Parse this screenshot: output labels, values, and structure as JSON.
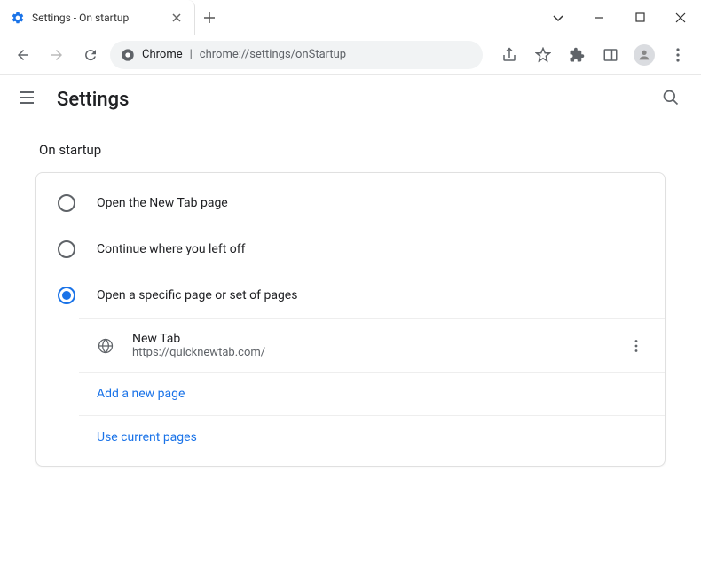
{
  "window": {
    "tab_title": "Settings - On startup"
  },
  "address_bar": {
    "prefix": "Chrome",
    "url": "chrome://settings/onStartup"
  },
  "header": {
    "title": "Settings"
  },
  "section": {
    "title": "On startup",
    "options": {
      "new_tab": "Open the New Tab page",
      "continue": "Continue where you left off",
      "specific": "Open a specific page or set of pages"
    },
    "pages": [
      {
        "name": "New Tab",
        "url": "https://quicknewtab.com/"
      }
    ],
    "add_page": "Add a new page",
    "use_current": "Use current pages"
  }
}
